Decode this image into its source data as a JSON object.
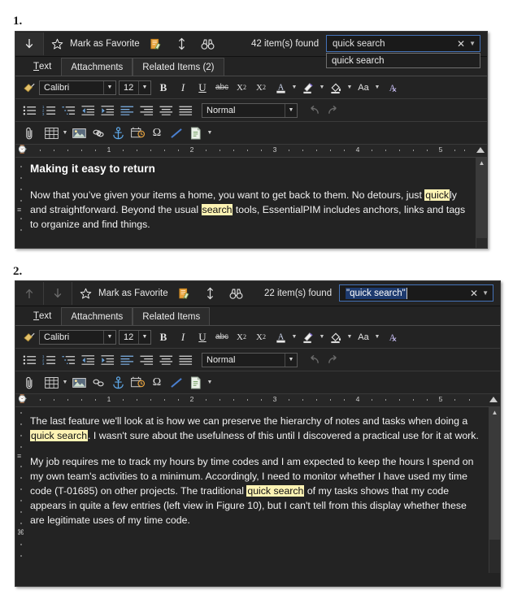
{
  "figures": {
    "one_label": "1.",
    "two_label": "2."
  },
  "colors": {
    "panel_bg": "#232323",
    "highlight": "#fdf3b4",
    "selection": "#1d3a6e",
    "search_border": "#4472b8",
    "text": "#f2f2f2"
  },
  "panel1": {
    "header": {
      "nav_down_icon": "arrow-down-icon",
      "favorite_star_icon": "star-icon",
      "favorite_label": "Mark as Favorite",
      "edit_icon": "edit-note-icon",
      "sort_icon": "sort-updown-icon",
      "binoculars_icon": "binoculars-icon",
      "found_text": "42 item(s) found"
    },
    "search": {
      "value": "quick search",
      "placeholder": "quick search",
      "clear_icon": "close-icon",
      "dropdown_icon": "chevron-down-icon",
      "suggestion": "quick search"
    },
    "tabs": [
      {
        "label": "Text",
        "underline_first": true,
        "active": true
      },
      {
        "label": "Attachments",
        "active": false
      },
      {
        "label": "Related Items  (2)",
        "active": false
      }
    ],
    "format_toolbar": {
      "brush_icon": "format-painter-icon",
      "font_name": "Calibri",
      "font_size": "12",
      "bold": "B",
      "italic": "I",
      "underline": "U",
      "strikethrough": "abc",
      "subscript": "X2",
      "superscript": "X2",
      "font_color_icon": "font-color-icon",
      "highlight_icon": "text-highlight-icon",
      "fill_icon": "fill-color-icon",
      "change_case": "Aa",
      "clear_format_icon": "clear-formatting-icon"
    },
    "paragraph_toolbar": {
      "bullets_icon": "bullet-list-icon",
      "numbering_icon": "numbered-list-icon",
      "multilevel_icon": "multilevel-list-icon",
      "indent_decrease_icon": "decrease-indent-icon",
      "indent_increase_icon": "increase-indent-icon",
      "align_left_icon": "align-left-icon",
      "align_center_icon": "align-center-icon",
      "align_right_icon": "align-right-icon",
      "align_justify_icon": "align-justify-icon",
      "style_name": "Normal",
      "undo_icon": "undo-icon",
      "redo_icon": "redo-icon"
    },
    "insert_toolbar": {
      "attach_icon": "paperclip-icon",
      "table_icon": "table-icon",
      "image_icon": "image-icon",
      "link_icon": "link-icon",
      "anchor_icon": "anchor-icon",
      "datetime_icon": "date-time-icon",
      "symbol_icon": "omega-symbol-icon",
      "line_icon": "horizontal-line-icon",
      "page_icon": "page-icon"
    },
    "ruler": {
      "numbers": [
        "1",
        "2",
        "3",
        "4",
        "5"
      ]
    },
    "document": {
      "heading": "Making it easy to return",
      "paragraph_parts": [
        {
          "t": "Now that you’ve given your items a home, you want to get back to them. No detours, just ",
          "h": false
        },
        {
          "t": "quick",
          "h": true
        },
        {
          "t": "ly and straightforward. Beyond the usual ",
          "h": false
        },
        {
          "t": "search",
          "h": true
        },
        {
          "t": " tools, EssentialPIM includes anchors, links and tags to organize and find things.",
          "h": false
        }
      ]
    }
  },
  "panel2": {
    "header": {
      "nav_up_icon": "arrow-up-icon",
      "nav_down_icon": "arrow-down-icon",
      "favorite_star_icon": "star-icon",
      "favorite_label": "Mark as Favorite",
      "edit_icon": "edit-note-icon",
      "sort_icon": "sort-updown-icon",
      "binoculars_icon": "binoculars-icon",
      "found_text": "22 item(s) found"
    },
    "search": {
      "value": "\"quick search\"",
      "selected": true,
      "clear_icon": "close-icon",
      "dropdown_icon": "chevron-down-icon"
    },
    "tabs": [
      {
        "label": "Text",
        "underline_first": true,
        "active": true
      },
      {
        "label": "Attachments",
        "active": false
      },
      {
        "label": "Related Items",
        "active": false
      }
    ],
    "format_toolbar": {
      "brush_icon": "format-painter-icon",
      "font_name": "Calibri",
      "font_size": "12",
      "bold": "B",
      "italic": "I",
      "underline": "U",
      "strikethrough": "abc",
      "subscript": "X2",
      "superscript": "X2",
      "font_color_icon": "font-color-icon",
      "highlight_icon": "text-highlight-icon",
      "fill_icon": "fill-color-icon",
      "change_case": "Aa",
      "clear_format_icon": "clear-formatting-icon"
    },
    "paragraph_toolbar": {
      "style_name": "Normal"
    },
    "ruler": {
      "numbers": [
        "1",
        "2",
        "3",
        "4",
        "5"
      ]
    },
    "document": {
      "p1_parts": [
        {
          "t": "The last feature we'll look at is how we can preserve the hierarchy of notes and tasks when doing a ",
          "h": false
        },
        {
          "t": "quick search",
          "h": true
        },
        {
          "t": ". I wasn't sure about the usefulness of this until I discovered a practical use for it at work.",
          "h": false
        }
      ],
      "p2_parts": [
        {
          "t": "My job requires me to track my hours by time codes and I am expected to keep the hours I spend on my own team's activities to a minimum. Accordingly, I need to monitor whether I have used my time code (T-01685) on other projects. The traditional ",
          "h": false
        },
        {
          "t": "quick search",
          "h": true
        },
        {
          "t": " of my tasks shows that my code appears in quite a few entries (left view in Figure 10), but I can't tell from this display whether these are legitimate uses of my time code.",
          "h": false
        }
      ]
    }
  }
}
